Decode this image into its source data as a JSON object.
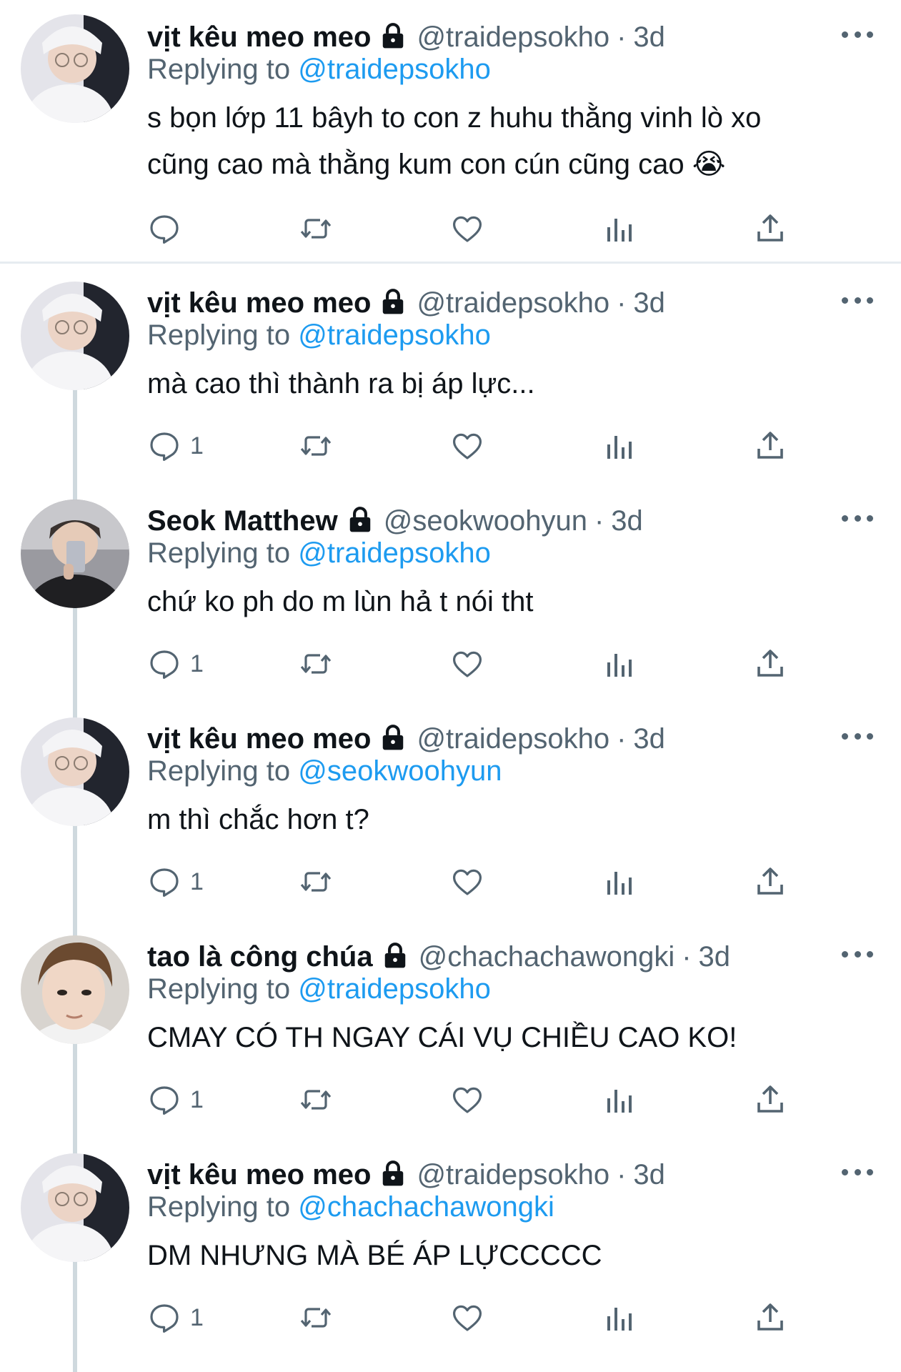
{
  "tweets": [
    {
      "name": "vịt kêu meo meo",
      "handle": "@traidepsokho",
      "time": "3d",
      "sep": "·",
      "replying_prefix": "Replying to",
      "replying_to": "@traidepsokho",
      "text_lines": [
        "s bọn lớp 11 bâyh to con z huhu thằng vinh lò xo",
        "cũng cao mà thằng kum con cún cũng cao 😭"
      ],
      "reply_count": ""
    },
    {
      "name": "vịt kêu meo meo",
      "handle": "@traidepsokho",
      "time": "3d",
      "sep": "·",
      "replying_prefix": "Replying to",
      "replying_to": "@traidepsokho",
      "text_lines": [
        "mà cao thì thành ra bị áp lực..."
      ],
      "reply_count": "1"
    },
    {
      "name": "Seok Matthew",
      "handle": "@seokwoohyun",
      "time": "3d",
      "sep": "·",
      "replying_prefix": "Replying to",
      "replying_to": "@traidepsokho",
      "text_lines": [
        "chứ ko ph do m lùn hả t nói tht"
      ],
      "reply_count": "1"
    },
    {
      "name": "vịt kêu meo meo",
      "handle": "@traidepsokho",
      "time": "3d",
      "sep": "·",
      "replying_prefix": "Replying to",
      "replying_to": "@seokwoohyun",
      "text_lines": [
        "m thì chắc hơn t?"
      ],
      "reply_count": "1"
    },
    {
      "name": "tao là công chúa",
      "handle": "@chachachawongki",
      "time": "3d",
      "sep": "·",
      "replying_prefix": "Replying to",
      "replying_to": "@traidepsokho",
      "text_lines": [
        "CMAY CÓ TH NGAY CÁI VỤ CHIỀU CAO KO!"
      ],
      "reply_count": "1"
    },
    {
      "name": "vịt kêu meo meo",
      "handle": "@traidepsokho",
      "time": "3d",
      "sep": "·",
      "replying_prefix": "Replying to",
      "replying_to": "@chachachawongki",
      "text_lines": [
        "DM NHƯNG MÀ BÉ ÁP LỰCCCCC"
      ],
      "reply_count": "1"
    }
  ],
  "icons": {
    "reply": "reply-icon",
    "retweet": "retweet-icon",
    "like": "heart-icon",
    "views": "analytics-icon",
    "share": "share-icon",
    "more": "more-icon",
    "lock": "lock-icon"
  },
  "colors": {
    "text": "#0f1419",
    "secondary": "#536471",
    "link": "#1d9bf0",
    "thread_line": "#cfd9de"
  }
}
